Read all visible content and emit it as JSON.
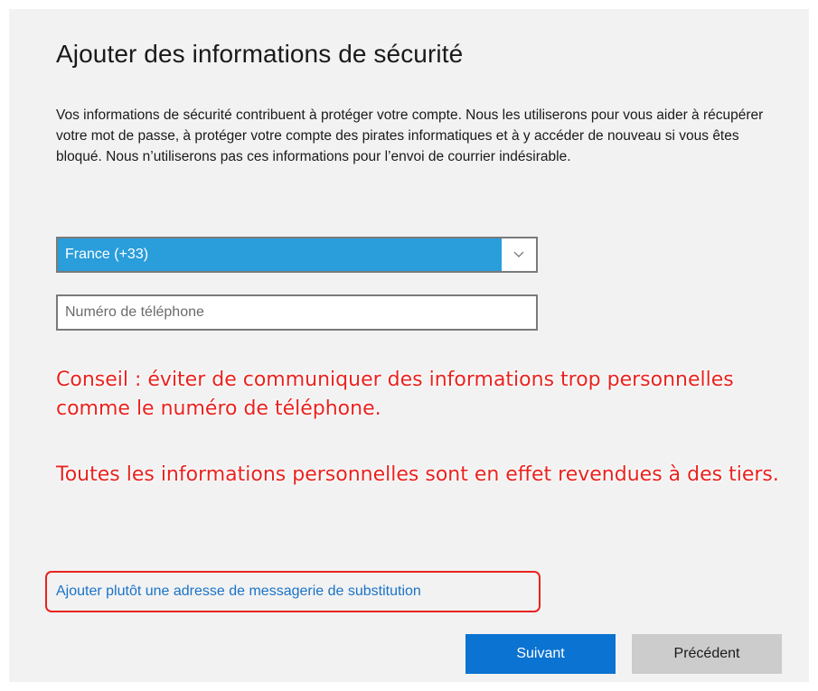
{
  "page": {
    "title": "Ajouter des informations de sécurité",
    "description": "Vos informations de sécurité contribuent à protéger votre compte. Nous les utiliserons pour vous aider à récupérer votre mot de passe, à protéger votre compte des pirates informatiques et à y accéder de nouveau si vous êtes bloqué. Nous n’utiliserons pas ces informations pour l’envoi de courrier indésirable."
  },
  "form": {
    "country_select": {
      "selected": "France (+33)",
      "icon": "chevron-down-icon"
    },
    "phone_input": {
      "value": "",
      "placeholder": "Numéro de téléphone"
    }
  },
  "annotations": {
    "tip": "Conseil : éviter de communiquer des informations trop personnelles comme le numéro de téléphone.",
    "resale": "Toutes les informations personnelles sont en effet revendues à des tiers."
  },
  "alt_email_link": {
    "label": "Ajouter plutôt une adresse de messagerie de substitution"
  },
  "buttons": {
    "next_label": "Suivant",
    "previous_label": "Précédent"
  },
  "colors": {
    "panel_background": "#f2f2f2",
    "select_highlight": "#2a9ddb",
    "primary_button": "#0b73d1",
    "secondary_button": "#cccccc",
    "link": "#1a73c8",
    "annotation_red": "#e8231f"
  }
}
